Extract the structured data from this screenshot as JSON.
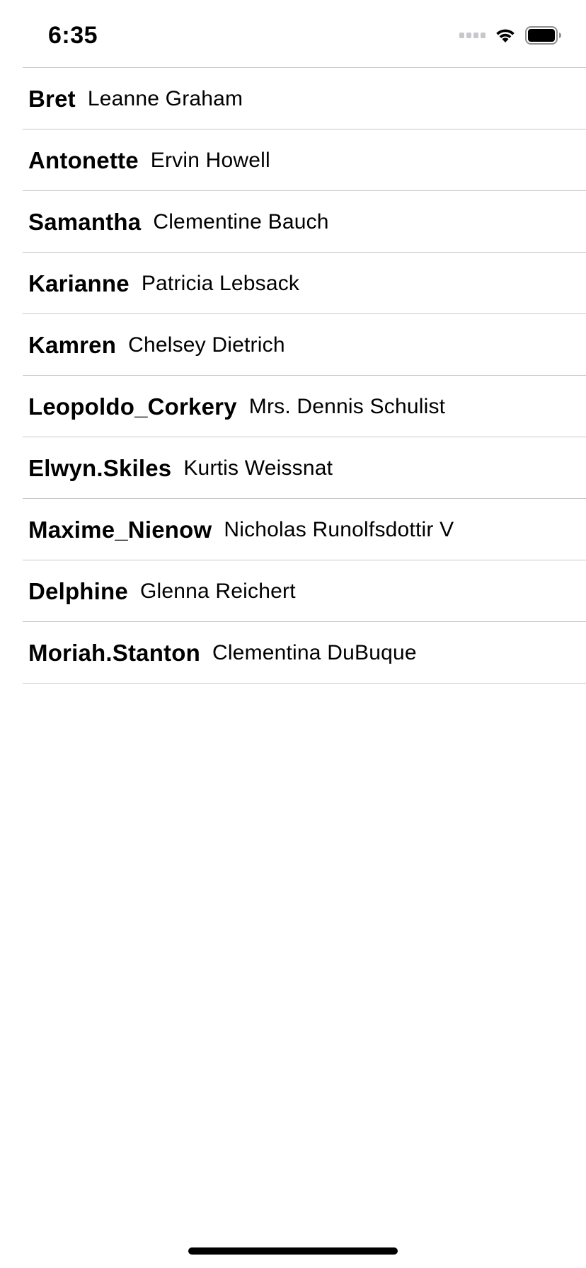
{
  "status_bar": {
    "time": "6:35",
    "icons": [
      "signal-icon",
      "wifi-icon",
      "battery-icon"
    ]
  },
  "users": [
    {
      "username": "Bret",
      "name": "Leanne Graham"
    },
    {
      "username": "Antonette",
      "name": "Ervin Howell"
    },
    {
      "username": "Samantha",
      "name": "Clementine Bauch"
    },
    {
      "username": "Karianne",
      "name": "Patricia Lebsack"
    },
    {
      "username": "Kamren",
      "name": "Chelsey Dietrich"
    },
    {
      "username": "Leopoldo_Corkery",
      "name": "Mrs. Dennis Schulist"
    },
    {
      "username": "Elwyn.Skiles",
      "name": "Kurtis Weissnat"
    },
    {
      "username": "Maxime_Nienow",
      "name": "Nicholas Runolfsdottir V"
    },
    {
      "username": "Delphine",
      "name": "Glenna Reichert"
    },
    {
      "username": "Moriah.Stanton",
      "name": "Clementina DuBuque"
    }
  ],
  "colors": {
    "separator": "#c8c7cc",
    "text": "#000000",
    "background": "#ffffff"
  }
}
